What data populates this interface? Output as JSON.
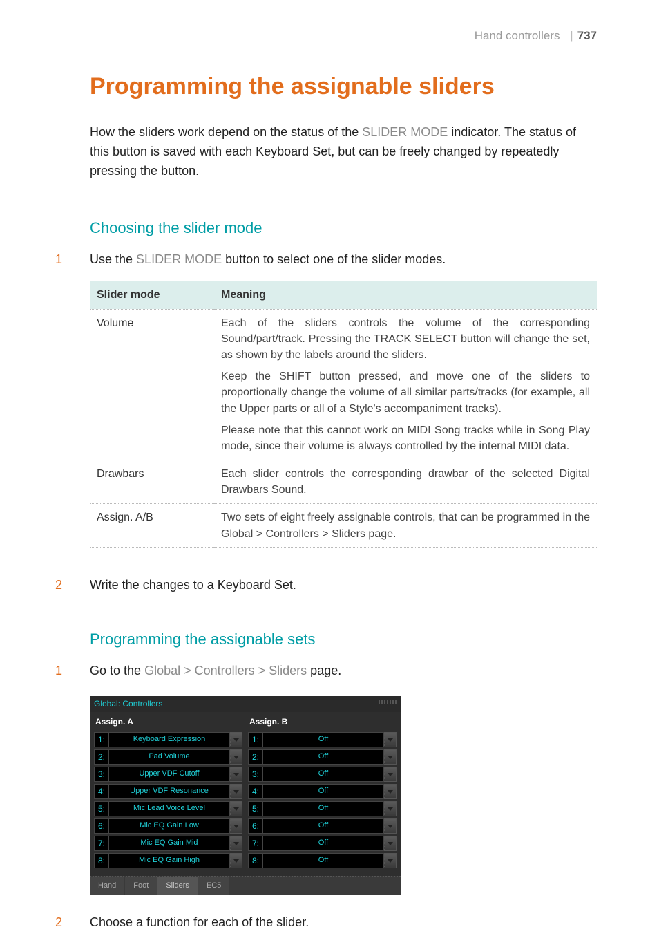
{
  "header": {
    "section": "Hand controllers",
    "page": "737"
  },
  "title": "Programming the assignable sliders",
  "intro": {
    "before": "How the sliders work depend on the status of the ",
    "em": "SLIDER MODE",
    "after": " indicator. The status of this button is saved with each Keyboard Set, but can be freely changed by repeatedly pressing the button."
  },
  "section1": {
    "heading": "Choosing the slider mode",
    "step1": {
      "num": "1",
      "before": "Use the ",
      "em": "SLIDER MODE",
      "after": " button to select one of the slider modes."
    },
    "table": {
      "head": {
        "col1": "Slider mode",
        "col2": "Meaning"
      },
      "rows": [
        {
          "mode": "Volume",
          "paras": [
            "Each of the sliders controls the volume of the corresponding Sound/part/track. Pressing the TRACK SELECT button will change the set, as shown by the labels around the sliders.",
            "Keep the SHIFT button pressed, and move one of the sliders to proportionally change the volume of all similar parts/tracks (for example, all the Upper parts or all of a Style's accompaniment tracks).",
            "Please note that this cannot work on MIDI Song tracks while in Song Play mode, since their volume is always controlled by the internal MIDI data."
          ]
        },
        {
          "mode": "Drawbars",
          "paras": [
            "Each slider controls the corresponding drawbar of the selected Digital Drawbars Sound."
          ]
        },
        {
          "mode": "Assign. A/B",
          "paras": [
            "Two sets of eight freely assignable controls, that can be programmed in the Global > Controllers > Sliders page."
          ]
        }
      ]
    },
    "step2": {
      "num": "2",
      "text": "Write the changes to a Keyboard Set."
    }
  },
  "section2": {
    "heading": "Programming the assignable sets",
    "step1": {
      "num": "1",
      "before": "Go to the ",
      "em": "Global > Controllers > Sliders",
      "after": " page."
    },
    "ui": {
      "title": "Global: Controllers",
      "colA": {
        "head": "Assign. A",
        "rows": [
          {
            "idx": "1:",
            "val": "Keyboard Expression"
          },
          {
            "idx": "2:",
            "val": "Pad Volume"
          },
          {
            "idx": "3:",
            "val": "Upper VDF Cutoff"
          },
          {
            "idx": "4:",
            "val": "Upper VDF Resonance"
          },
          {
            "idx": "5:",
            "val": "Mic Lead Voice Level"
          },
          {
            "idx": "6:",
            "val": "Mic EQ Gain Low"
          },
          {
            "idx": "7:",
            "val": "Mic EQ Gain Mid"
          },
          {
            "idx": "8:",
            "val": "Mic EQ Gain High"
          }
        ]
      },
      "colB": {
        "head": "Assign. B",
        "rows": [
          {
            "idx": "1:",
            "val": "Off"
          },
          {
            "idx": "2:",
            "val": "Off"
          },
          {
            "idx": "3:",
            "val": "Off"
          },
          {
            "idx": "4:",
            "val": "Off"
          },
          {
            "idx": "5:",
            "val": "Off"
          },
          {
            "idx": "6:",
            "val": "Off"
          },
          {
            "idx": "7:",
            "val": "Off"
          },
          {
            "idx": "8:",
            "val": "Off"
          }
        ]
      },
      "tabs": [
        "Hand",
        "Foot",
        "Sliders",
        "EC5"
      ]
    },
    "step2": {
      "num": "2",
      "text": "Choose a function for each of the slider."
    }
  }
}
